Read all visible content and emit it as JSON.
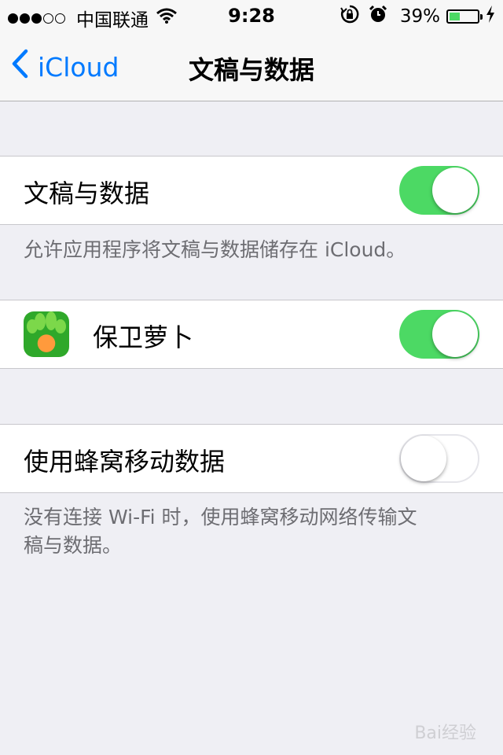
{
  "status_bar": {
    "signal_dots_filled": 3,
    "signal_dots_total": 5,
    "carrier": "中国联通",
    "time": "9:28",
    "battery_percent": "39%",
    "battery_level": 0.39,
    "icons": [
      "wifi-icon",
      "rotation-lock-icon",
      "alarm-icon",
      "charging-icon"
    ]
  },
  "nav": {
    "back_label": "iCloud",
    "title": "文稿与数据"
  },
  "settings": {
    "docs_toggle_label": "文稿与数据",
    "docs_toggle_on": true,
    "docs_footer": "允许应用程序将文稿与数据储存在 iCloud。",
    "app_name": "保卫萝卜",
    "app_toggle_on": true,
    "cellular_label": "使用蜂窝移动数据",
    "cellular_on": false,
    "cellular_footer_line1": "没有连接 Wi-Fi 时，使用蜂窝移动网络传输文",
    "cellular_footer_line2": "稿与数据。"
  },
  "watermark": "Bai经验",
  "colors": {
    "accent": "#007aff",
    "switch_on": "#4cd964",
    "background": "#efeff4"
  }
}
